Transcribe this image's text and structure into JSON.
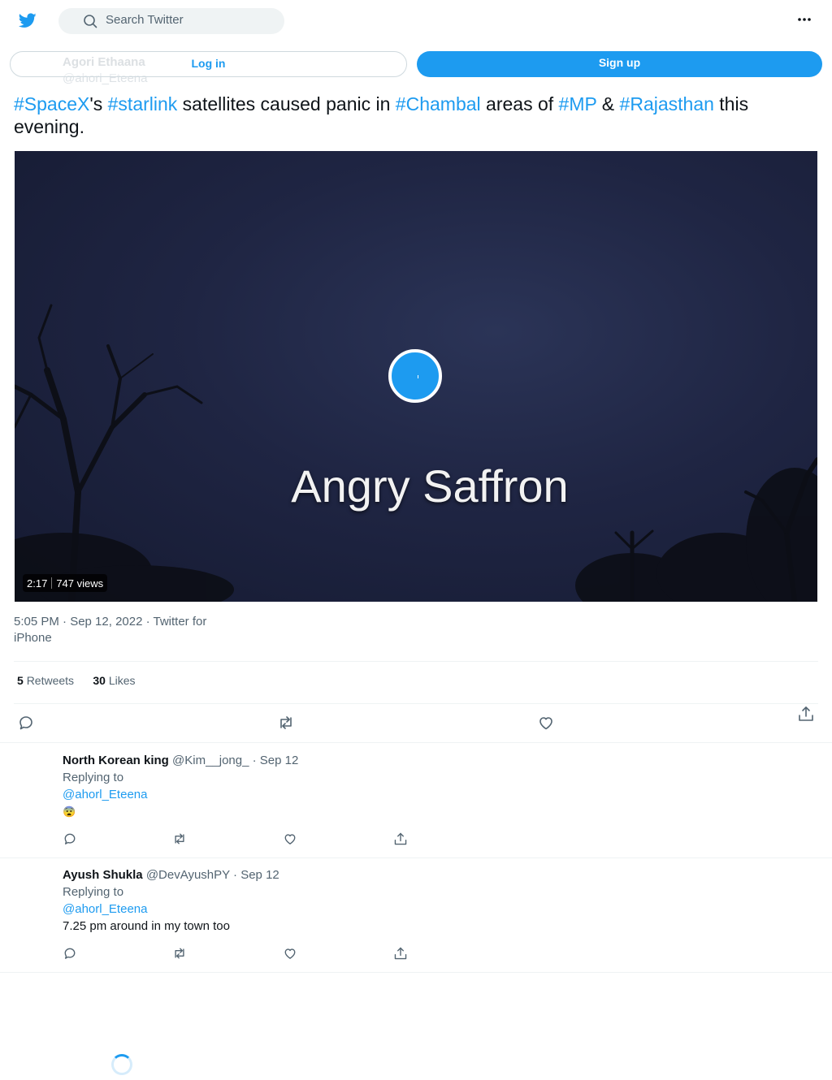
{
  "header": {
    "search_placeholder": "Search Twitter",
    "logo_icon": "twitter-bird-icon",
    "more_icon": "more-dots-icon"
  },
  "author": {
    "name": "Agori Ethaana",
    "handle": "@ahorl_Eteena"
  },
  "auth": {
    "login_label": "Log in",
    "signup_label": "Sign up"
  },
  "tweet": {
    "text_parts": [
      {
        "text": "#SpaceX",
        "link": true
      },
      {
        "text": "'s ",
        "link": false
      },
      {
        "text": "#starlink",
        "link": true
      },
      {
        "text": " satellites caused panic in ",
        "link": false
      },
      {
        "text": "#Chambal",
        "link": true
      },
      {
        "text": " areas of ",
        "link": false
      },
      {
        "text": "#MP",
        "link": true
      },
      {
        "text": " & ",
        "link": false
      },
      {
        "text": "#Rajasthan",
        "link": true
      },
      {
        "text": " this evening.",
        "link": false
      }
    ],
    "video_overlay_text": "Angry Saffron",
    "video_duration": "2:17",
    "video_views": "747 views",
    "timestamp_line1": "5:05 PM · Sep 12, 2022 · Twitter for",
    "timestamp_line2": "iPhone",
    "retweets_count": "5",
    "retweets_label": "Retweets",
    "likes_count": "30",
    "likes_label": "Likes"
  },
  "replies": [
    {
      "name": "North Korean king",
      "handle": "@Kim__jong_",
      "date": "· Sep 12",
      "replying_label": "Replying to",
      "replying_to": "@ahorl_Eteena",
      "text": "😨"
    },
    {
      "name": "Ayush Shukla",
      "handle": "@DevAyushPY",
      "date": "· Sep 12",
      "replying_label": "Replying to",
      "replying_to": "@ahorl_Eteena",
      "text": "7.25 pm around in my town too"
    }
  ],
  "colors": {
    "accent": "#1d9bf0",
    "text": "#0f1419",
    "muted": "#536471"
  }
}
